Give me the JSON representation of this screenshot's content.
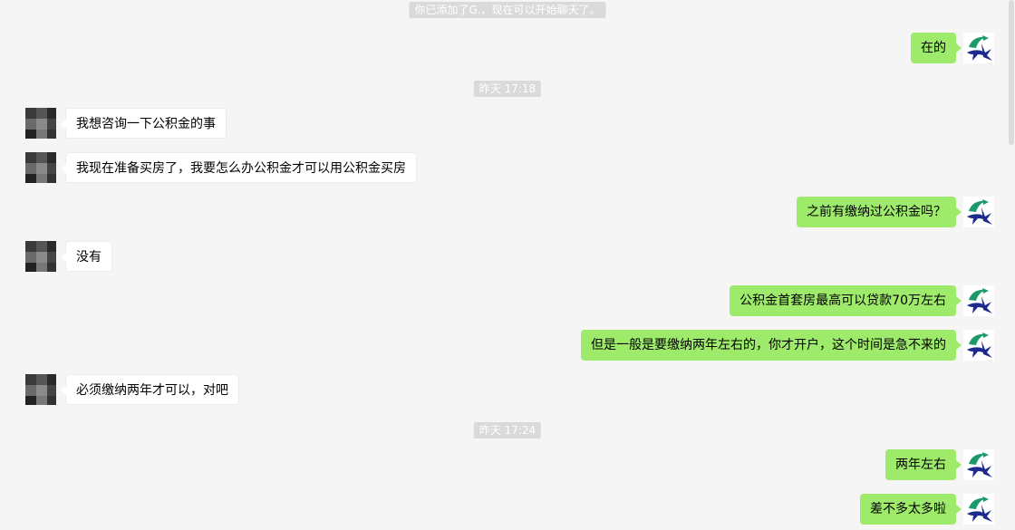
{
  "system_notice": "你已添加了G.，现在可以开始聊天了。",
  "timestamps": [
    "昨天 17:18",
    "昨天 17:24"
  ],
  "messages": [
    {
      "side": "out",
      "text": "在的"
    },
    {
      "side": "in",
      "text": "我想咨询一下公积金的事"
    },
    {
      "side": "in",
      "text": "我现在准备买房了，我要怎么办公积金才可以用公积金买房"
    },
    {
      "side": "out",
      "text": "之前有缴纳过公积金吗？"
    },
    {
      "side": "in",
      "text": "没有"
    },
    {
      "side": "out",
      "text": "公积金首套房最高可以贷款70万左右"
    },
    {
      "side": "out",
      "text": "但是一般是要缴纳两年左右的，你才开户，这个时间是急不来的"
    },
    {
      "side": "in",
      "text": "必须缴纳两年才可以，对吧"
    },
    {
      "side": "out",
      "text": "两年左右"
    },
    {
      "side": "out",
      "text": "差不多太多啦"
    }
  ],
  "avatars": {
    "self": "logo-avatar-icon",
    "contact": "pixelated-avatar-icon"
  },
  "colors": {
    "background": "#f5f5f5",
    "outgoing_bubble": "#9eea6a",
    "incoming_bubble": "#ffffff",
    "system_label": "#dadada"
  }
}
